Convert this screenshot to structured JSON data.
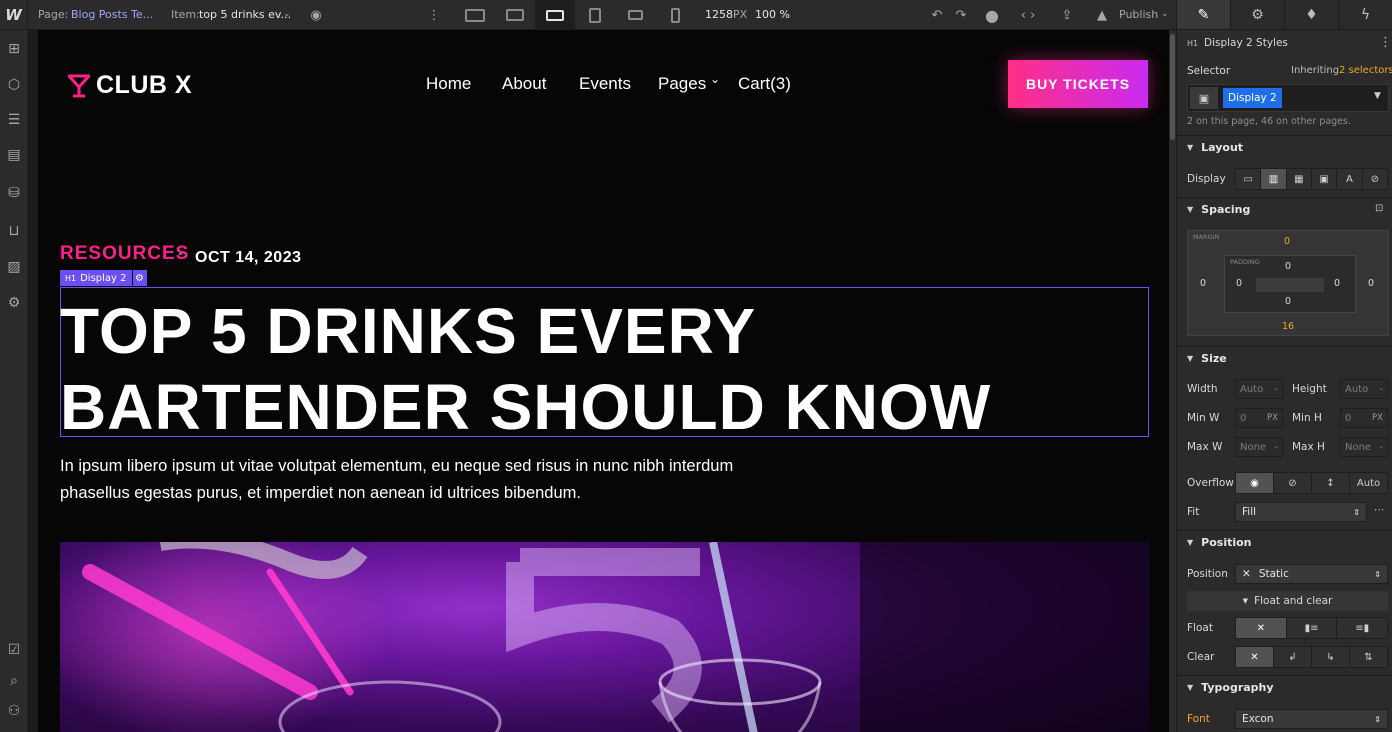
{
  "topbar": {
    "page_label": "Page:",
    "page_value": "Blog Posts Te...",
    "item_label": "Item:",
    "item_value": "top 5 drinks ev...",
    "width_value": "1258",
    "width_unit": "PX",
    "zoom": "100 %",
    "publish_label": "Publish"
  },
  "site": {
    "brand": "CLUB X",
    "nav": [
      "Home",
      "About",
      "Events",
      "Pages",
      "Cart(3)"
    ],
    "cta": "BUY TICKETS",
    "category": "RESOURCES",
    "separator": "-",
    "date": "OCT 14, 2023",
    "selected_tag": "Display 2",
    "selected_tag_prefix": "H1",
    "heading": "TOP 5 DRINKS EVERY BARTENDER SHOULD KNOW",
    "lead": "In ipsum libero ipsum ut vitae volutpat elementum, eu neque sed risus in nunc nibh interdum phasellus egestas purus, et imperdiet non aenean id ultrices bibendum."
  },
  "panel": {
    "title_prefix": "H1",
    "title": "Display 2 Styles",
    "selector_label": "Selector",
    "inheriting_label": "Inheriting",
    "inheriting_count": "2 selectors",
    "selector_chip": "Display 2",
    "selector_note": "2 on this page, 46 on other pages.",
    "layout": {
      "section": "Layout",
      "display_label": "Display"
    },
    "spacing": {
      "section": "Spacing",
      "margin_label": "MARGIN",
      "padding_label": "PADDING",
      "margin_top": "0",
      "margin_right": "0",
      "margin_bottom": "16",
      "margin_left": "0",
      "padding_top": "0",
      "padding_right": "0",
      "padding_bottom": "0",
      "padding_left": "0"
    },
    "size": {
      "section": "Size",
      "width_label": "Width",
      "width_value": "Auto",
      "width_unit": "-",
      "height_label": "Height",
      "height_value": "Auto",
      "height_unit": "-",
      "minw_label": "Min W",
      "minw_value": "0",
      "minw_unit": "PX",
      "minh_label": "Min H",
      "minh_value": "0",
      "minh_unit": "PX",
      "maxw_label": "Max W",
      "maxw_value": "None",
      "maxw_unit": "-",
      "maxh_label": "Max H",
      "maxh_value": "None",
      "maxh_unit": "-",
      "overflow_label": "Overflow",
      "overflow_auto": "Auto",
      "fit_label": "Fit",
      "fit_value": "Fill"
    },
    "position": {
      "section": "Position",
      "position_label": "Position",
      "position_value": "Static",
      "float_clear_toggle": "Float and clear",
      "float_label": "Float",
      "clear_label": "Clear"
    },
    "typography": {
      "section": "Typography",
      "font_label": "Font",
      "font_value": "Excon"
    }
  },
  "colors": {
    "accent_pink": "#ff1f8a",
    "selection_purple": "#6b4ff0",
    "chip_blue": "#1f6feb",
    "panel_bg": "#2b2b2b",
    "canvas_bg": "#060606"
  }
}
